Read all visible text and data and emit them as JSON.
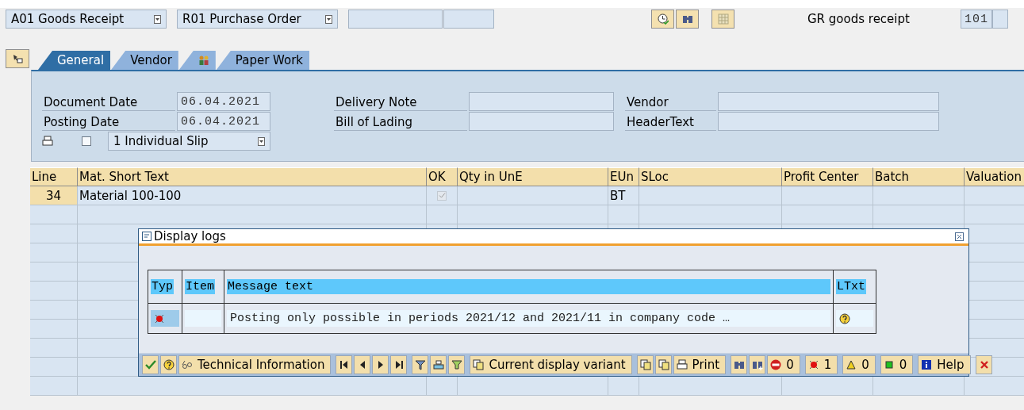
{
  "header": {
    "dropdowns": [
      "A01 Goods Receipt",
      "R01 Purchase Order"
    ],
    "title": "GR goods receipt",
    "movement_type": "101"
  },
  "tabs": [
    {
      "label": "General",
      "selected": true,
      "kind": "text"
    },
    {
      "label": "Vendor",
      "selected": false,
      "kind": "text"
    },
    {
      "selected": false,
      "kind": "icon"
    },
    {
      "label": "Paper Work",
      "selected": false,
      "kind": "text"
    }
  ],
  "form": {
    "left": [
      {
        "label": "Document Date",
        "value": "06.04.2021"
      },
      {
        "label": "Posting Date",
        "value": "06.04.2021"
      }
    ],
    "print": {
      "checked": false,
      "slip": "1 Individual Slip"
    },
    "middle": [
      {
        "label": "Delivery Note"
      },
      {
        "label": "Bill of Lading"
      }
    ],
    "right": [
      {
        "label": "Vendor"
      },
      {
        "label": "HeaderText"
      }
    ]
  },
  "table": {
    "columns": [
      "Line",
      "Mat. Short Text",
      "OK",
      "Qty in UnE",
      "EUn",
      "SLoc",
      "Profit Center",
      "Batch",
      "Valuation"
    ],
    "rows": [
      {
        "line": "34",
        "text": "Material 100-100",
        "ok": {
          "checked": true,
          "disabled": true
        },
        "eun": "BT"
      }
    ]
  },
  "dialog": {
    "title": "Display logs",
    "columns": [
      "Typ",
      "Item",
      "Message text",
      "LTxt"
    ],
    "rows": [
      {
        "message": "Posting only possible in periods 2021/12 and 2021/11 in company code …"
      }
    ],
    "toolbar": [
      "Technical Information",
      "Current display variant",
      "Print",
      "0",
      "1",
      "0",
      "0",
      "Help"
    ]
  }
}
